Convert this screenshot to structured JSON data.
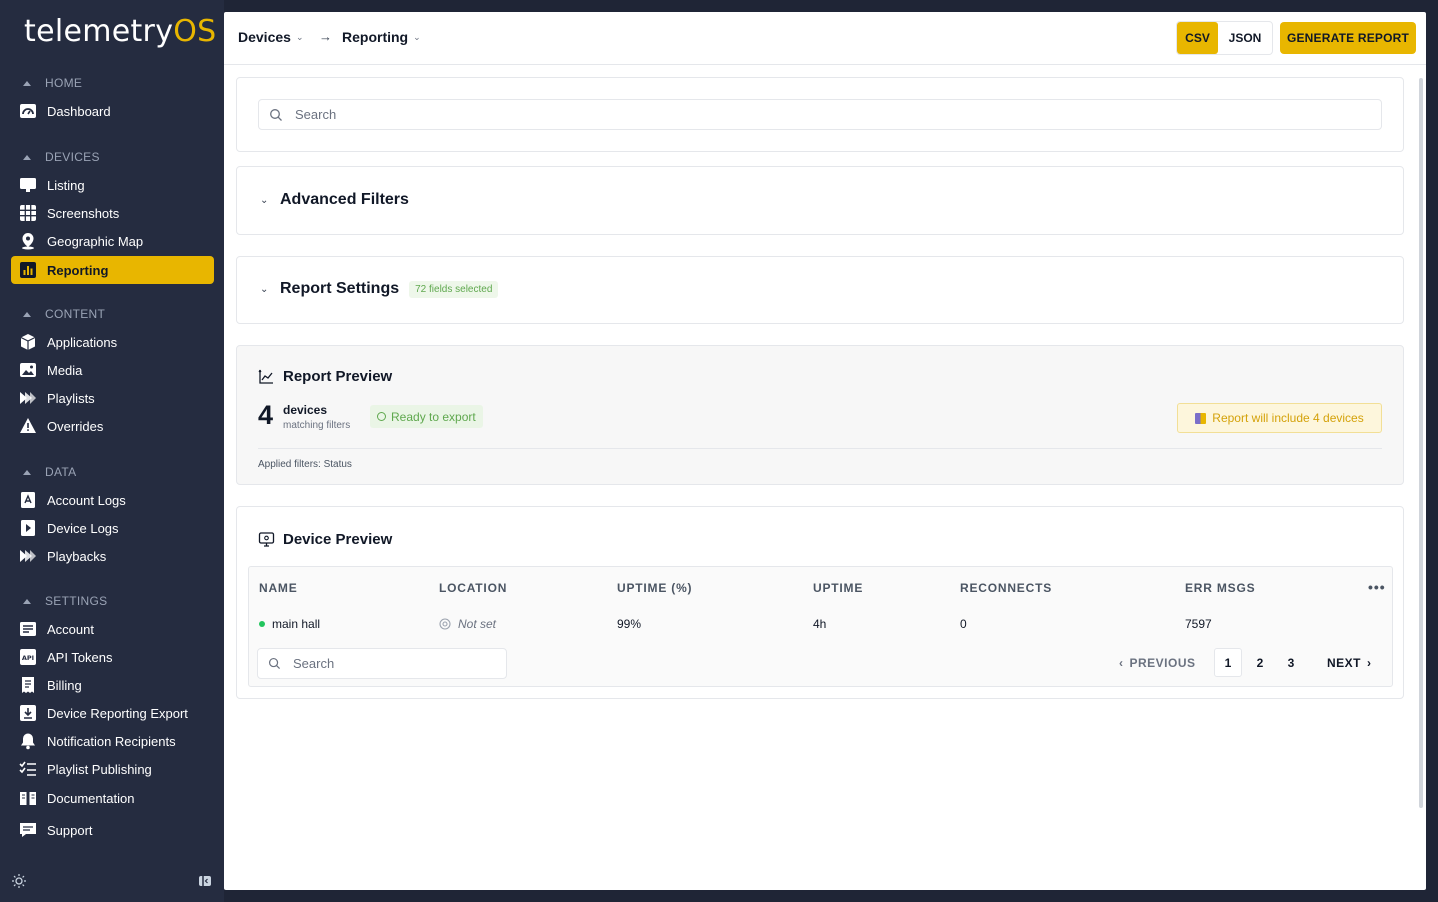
{
  "brand": {
    "name": "telemetry",
    "suffix": "OS"
  },
  "sidebar": {
    "sections": [
      {
        "label": "HOME"
      },
      {
        "label": "DEVICES"
      },
      {
        "label": "CONTENT"
      },
      {
        "label": "DATA"
      },
      {
        "label": "SETTINGS"
      }
    ],
    "items": [
      {
        "label": "Dashboard",
        "icon": "dashboard-icon"
      },
      {
        "label": "Listing",
        "icon": "monitor-icon"
      },
      {
        "label": "Screenshots",
        "icon": "grid-icon"
      },
      {
        "label": "Geographic Map",
        "icon": "map-pin-icon"
      },
      {
        "label": "Reporting",
        "icon": "bar-chart-icon",
        "active": true
      },
      {
        "label": "Applications",
        "icon": "cube-icon"
      },
      {
        "label": "Media",
        "icon": "image-icon"
      },
      {
        "label": "Playlists",
        "icon": "playlist-icon"
      },
      {
        "label": "Overrides",
        "icon": "warning-icon"
      },
      {
        "label": "Account Logs",
        "icon": "account-log-icon"
      },
      {
        "label": "Device Logs",
        "icon": "play-log-icon"
      },
      {
        "label": "Playbacks",
        "icon": "playback-icon"
      },
      {
        "label": "Account",
        "icon": "id-card-icon"
      },
      {
        "label": "API Tokens",
        "icon": "api-icon"
      },
      {
        "label": "Billing",
        "icon": "receipt-icon"
      },
      {
        "label": "Device Reporting Export",
        "icon": "download-icon"
      },
      {
        "label": "Notification Recipients",
        "icon": "bell-icon"
      },
      {
        "label": "Playlist Publishing",
        "icon": "list-check-icon"
      },
      {
        "label": "Documentation",
        "icon": "book-icon"
      },
      {
        "label": "Support",
        "icon": "chat-icon"
      }
    ]
  },
  "header": {
    "breadcrumb": [
      "Devices",
      "Reporting"
    ],
    "formats": [
      "CSV",
      "JSON"
    ],
    "selected_format": "CSV",
    "generate_label": "GENERATE REPORT"
  },
  "search": {
    "placeholder": "Search"
  },
  "advanced_filters": {
    "title": "Advanced Filters"
  },
  "report_settings": {
    "title": "Report Settings",
    "badge": "72 fields selected"
  },
  "report_preview": {
    "title": "Report Preview",
    "count": "4",
    "count_label": "devices",
    "count_sub": "matching filters",
    "status": "Ready to export",
    "include_note": "Report will include 4 devices",
    "applied": "Applied filters: Status"
  },
  "device_preview": {
    "title": "Device Preview",
    "columns": [
      "NAME",
      "LOCATION",
      "UPTIME (%)",
      "UPTIME",
      "RECONNECTS",
      "ERR MSGS"
    ],
    "rows": [
      {
        "name": "main hall",
        "status": "online",
        "location": "Not set",
        "uptime_pct": "99%",
        "uptime": "4h",
        "reconnects": "0",
        "err_msgs": "7597"
      }
    ],
    "search_placeholder": "Search",
    "pagination": {
      "prev": "PREVIOUS",
      "pages": [
        "1",
        "2",
        "3"
      ],
      "current": "1",
      "next": "NEXT"
    }
  },
  "colors": {
    "accent": "#e8b600",
    "sidebar_bg": "#252c40",
    "success": "#5fa84e"
  }
}
